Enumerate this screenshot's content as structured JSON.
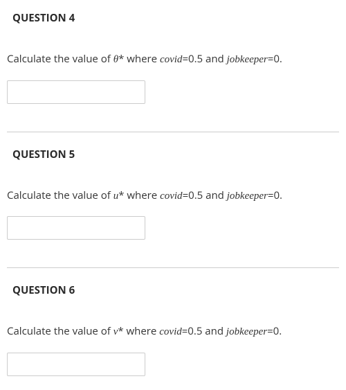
{
  "questions": {
    "q4": {
      "heading": "QUESTION 4",
      "prompt_prefix": "Calculate the value of  ",
      "symbol": "θ",
      "star": "*",
      "prompt_where": " where ",
      "var_covid": "covid",
      "eq_covid": "=0.5 and ",
      "var_jk": "jobkeeper",
      "eq_jk": "=0."
    },
    "q5": {
      "heading": "QUESTION 5",
      "prompt_prefix": "Calculate the value of ",
      "symbol": "u",
      "star": "*",
      "prompt_where": " where ",
      "var_covid": "covid",
      "eq_covid": "=0.5 and ",
      "var_jk": "jobkeeper",
      "eq_jk": "=0."
    },
    "q6": {
      "heading": "QUESTION 6",
      "prompt_prefix": "Calculate the value of ",
      "symbol": "v",
      "star": "*",
      "prompt_where": " where ",
      "var_covid": "covid",
      "eq_covid": "=0.5 and ",
      "var_jk": "jobkeeper",
      "eq_jk": "=0."
    }
  }
}
